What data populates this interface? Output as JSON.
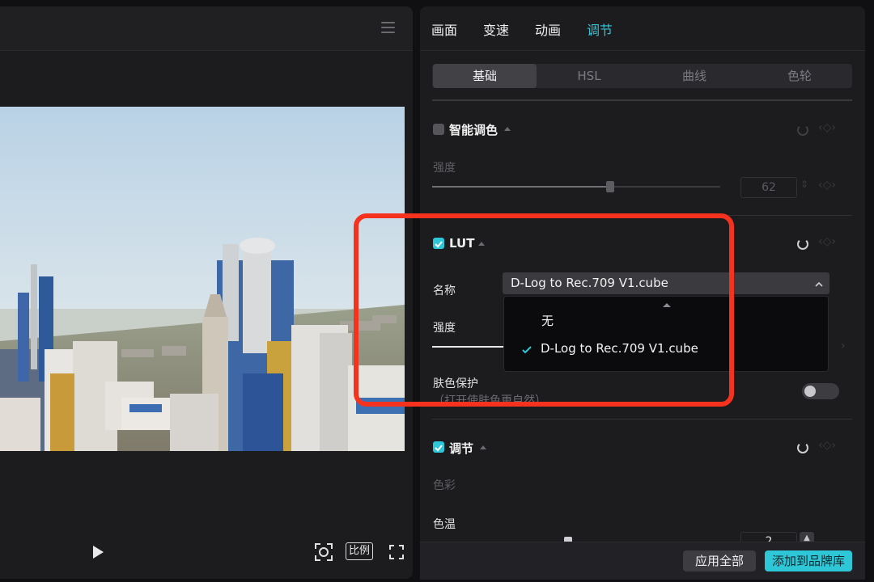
{
  "player": {
    "menu_icon": "hamburger-menu-icon",
    "controls": {
      "play_icon": "play-icon",
      "fit_icon": "fit-screen-icon",
      "ratio_label": "比例",
      "fullscreen_icon": "fullscreen-icon"
    }
  },
  "panel": {
    "tabs": [
      {
        "label": "画面"
      },
      {
        "label": "变速"
      },
      {
        "label": "动画"
      },
      {
        "label": "调节",
        "active": true
      }
    ],
    "subtabs": [
      {
        "label": "基础",
        "active": true
      },
      {
        "label": "HSL"
      },
      {
        "label": "曲线"
      },
      {
        "label": "色轮"
      }
    ],
    "smart_color": {
      "title": "智能调色",
      "checked": false,
      "strength_label": "强度",
      "strength_value": "62",
      "strength_fraction": 0.62
    },
    "lut": {
      "title": "LUT",
      "checked": true,
      "name_label": "名称",
      "selected": "D-Log to Rec.709 V1.cube",
      "options": [
        "无",
        "D-Log to Rec.709 V1.cube"
      ],
      "strength_label": "强度",
      "skin_protect_label": "肤色保护",
      "skin_protect_hint": "（打开使肤色更自然）",
      "skin_protect_on": false
    },
    "adjust": {
      "title": "调节",
      "checked": true,
      "color_label": "色彩",
      "temp_label": "色温",
      "temp_value": "2"
    }
  },
  "footer": {
    "apply_all_label": "应用全部",
    "add_brand_label": "添加到品牌库"
  },
  "colors": {
    "accent": "#2ec7d8",
    "highlight": "#f5321e",
    "panel_bg": "#1c1c1f"
  }
}
